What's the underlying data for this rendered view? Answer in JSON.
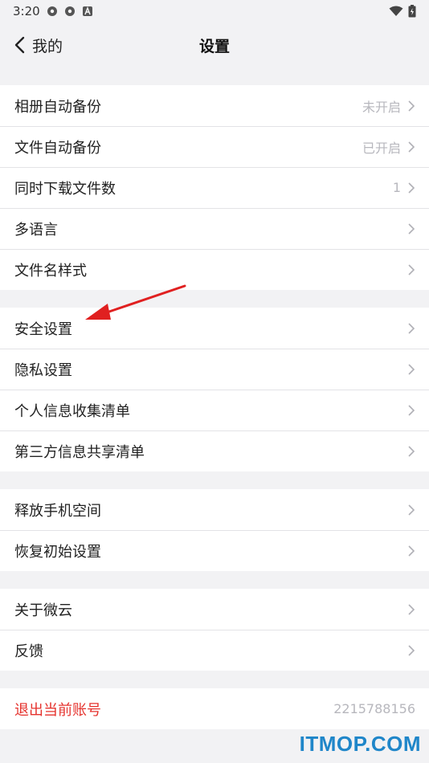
{
  "status": {
    "time": "3:20"
  },
  "nav": {
    "back_label": "我的",
    "title": "设置"
  },
  "groups": [
    {
      "rows": [
        {
          "label": "相册自动备份",
          "value": "未开启"
        },
        {
          "label": "文件自动备份",
          "value": "已开启"
        },
        {
          "label": "同时下载文件数",
          "value": "1"
        },
        {
          "label": "多语言",
          "value": ""
        },
        {
          "label": "文件名样式",
          "value": ""
        }
      ]
    },
    {
      "rows": [
        {
          "label": "安全设置",
          "value": ""
        },
        {
          "label": "隐私设置",
          "value": ""
        },
        {
          "label": "个人信息收集清单",
          "value": ""
        },
        {
          "label": "第三方信息共享清单",
          "value": ""
        }
      ]
    },
    {
      "rows": [
        {
          "label": "释放手机空间",
          "value": ""
        },
        {
          "label": "恢复初始设置",
          "value": ""
        }
      ]
    },
    {
      "rows": [
        {
          "label": "关于微云",
          "value": ""
        },
        {
          "label": "反馈",
          "value": ""
        }
      ]
    }
  ],
  "logout": {
    "label": "退出当前账号",
    "account": "2215788156"
  },
  "watermark": "ITMOP.COM",
  "colors": {
    "accent_red": "#e5322d",
    "watermark_blue": "#1f86c9",
    "arrow_red": "#e02020"
  }
}
